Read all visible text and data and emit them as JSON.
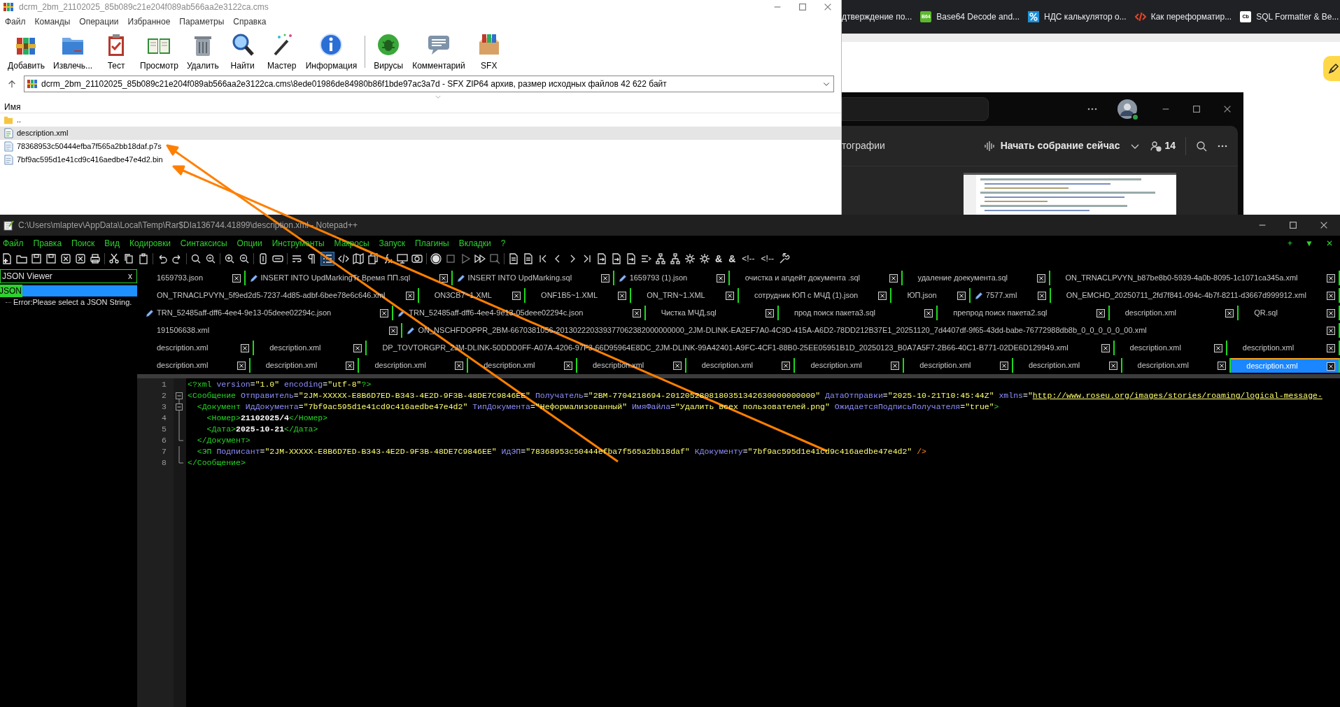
{
  "browser": {
    "bookmarks": [
      {
        "label": "дтверждение по...",
        "kind": "none"
      },
      {
        "label": "Base64 Decode and...",
        "kind": "b64",
        "badge": "B64"
      },
      {
        "label": "НДС калькулятор о...",
        "kind": "percent"
      },
      {
        "label": "Как переформатир...",
        "kind": "code"
      },
      {
        "label": "SQL Formatter & Be...",
        "kind": "cb",
        "badge": "Cb"
      }
    ]
  },
  "winrar": {
    "title": "dcrm_2bm_21102025_85b089c21e204f089ab566aa2e3122ca.cms",
    "menu": [
      "Файл",
      "Команды",
      "Операции",
      "Избранное",
      "Параметры",
      "Справка"
    ],
    "toolbar": [
      "Добавить",
      "Извлечь...",
      "Тест",
      "Просмотр",
      "Удалить",
      "Найти",
      "Мастер",
      "Информация",
      "Вирусы",
      "Комментарий",
      "SFX"
    ],
    "address": "dcrm_2bm_21102025_85b089c21e204f089ab566aa2e3122ca.cms\\8ede01986de84980b86f1bde97ac3a7d - SFX ZIP64 архив, размер исходных файлов 42 622 байт",
    "column": "Имя",
    "files": [
      {
        "name": "..",
        "kind": "parent",
        "selected": false
      },
      {
        "name": "description.xml",
        "kind": "xml",
        "selected": true
      },
      {
        "name": "78368953c50444efba7f565a2bb18daf.p7s",
        "kind": "file",
        "selected": false
      },
      {
        "name": "7bf9ac595d1e41cd9c416aedbe47e4d2.bin",
        "kind": "file",
        "selected": false
      }
    ]
  },
  "teams": {
    "tab_label": "тографии",
    "meeting_button": "Начать собрание сейчас",
    "participants": "14"
  },
  "notepad": {
    "title": "C:\\Users\\mlaptev\\AppData\\Local\\Temp\\Rar$DIa136744.41899\\description.xml - Notepad++",
    "menu": [
      "Файл",
      "Правка",
      "Поиск",
      "Вид",
      "Кодировки",
      "Синтаксисы",
      "Опции",
      "Инструменты",
      "Макросы",
      "Запуск",
      "Плагины",
      "Вкладки",
      "?"
    ],
    "menu_right": [
      "+",
      "▼",
      "✕"
    ],
    "toolbar_glyphs": [
      "&",
      "&",
      "<!--",
      "<!--"
    ],
    "panel": {
      "title": "JSON Viewer",
      "close": "x",
      "root": "JSON",
      "message": "Error:Please select a JSON String."
    },
    "tab_rows": [
      [
        {
          "label": "1659793.json",
          "modified": false,
          "selected": false
        },
        {
          "label": "INSERT INTO UpdMarkingTr Время ПП.sql",
          "modified": true,
          "selected": false
        },
        {
          "label": "INSERT INTO UpdMarking.sql",
          "modified": true,
          "selected": false
        },
        {
          "label": "1659793 (1).json",
          "modified": true,
          "selected": false
        },
        {
          "label": "очистка и апдейт документа .sql",
          "modified": false,
          "selected": false
        },
        {
          "label": "удаление доекумента.sql",
          "modified": false,
          "selected": false
        },
        {
          "label": "ON_TRNACLPVYN_b87be8b0-5939-4a0b-8095-1c1071ca345a.xml",
          "modified": false,
          "selected": false
        }
      ],
      [
        {
          "label": "ON_TRNACLPVYN_5f9ed2d5-7237-4d85-adbf-6bee78e6c646.xml",
          "modified": false,
          "selected": false
        },
        {
          "label": "ON3CB7~1.XML",
          "modified": false,
          "selected": false
        },
        {
          "label": "ONF1B5~1.XML",
          "modified": false,
          "selected": false
        },
        {
          "label": "ON_TRN~1.XML",
          "modified": false,
          "selected": false
        },
        {
          "label": "сотрудник ЮП с МЧД (1).json",
          "modified": false,
          "selected": false
        },
        {
          "label": "ЮП.json",
          "modified": false,
          "selected": false
        },
        {
          "label": "7577.xml",
          "modified": true,
          "selected": false
        },
        {
          "label": "ON_EMCHD_20250711_2fd7f841-094c-4b7f-8211-d3667d999912.xml",
          "modified": false,
          "selected": false
        }
      ],
      [
        {
          "label": "TRN_52485aff-dff6-4ee4-9e13-05deee02294c.json",
          "modified": true,
          "selected": false
        },
        {
          "label": "TRN_52485aff-dff6-4ee4-9e13-05deee02294c.json",
          "modified": true,
          "selected": false
        },
        {
          "label": "Чистка МЧД.sql",
          "modified": false,
          "selected": false
        },
        {
          "label": "прод поиск пакета3.sql",
          "modified": false,
          "selected": false
        },
        {
          "label": "препрод поиск пакета2.sql",
          "modified": false,
          "selected": false
        },
        {
          "label": "description.xml",
          "modified": false,
          "selected": false
        },
        {
          "label": "QR.sql",
          "modified": false,
          "selected": false
        }
      ],
      [
        {
          "label": "191506638.xml",
          "modified": false,
          "selected": false
        },
        {
          "label": "ON_NSCHFDOPPR_2BM-6670381056-201302220339377062382000000000_2JM-DLINK-EA2EF7A0-4C9D-415A-A6D2-78DD212B37E1_20251120_7d4407df-9f65-43dd-babe-76772988db8b_0_0_0_0_0_00.xml",
          "modified": true,
          "selected": false
        }
      ],
      [
        {
          "label": "description.xml",
          "modified": false,
          "selected": false
        },
        {
          "label": "description.xml",
          "modified": false,
          "selected": false
        },
        {
          "label": "DP_TOVTORGPR_2JM-DLINK-50DDD0FF-A07A-4206-97F3-66D95964E8DC_2JM-DLINK-99A42401-A9FC-4CF1-88B0-25EE05951B1D_20250123_B0A7A5F7-2B66-40C1-B771-02DE6D129949.xml",
          "modified": false,
          "selected": false
        },
        {
          "label": "description.xml",
          "modified": false,
          "selected": false
        },
        {
          "label": "description.xml",
          "modified": false,
          "selected": false
        }
      ],
      [
        {
          "label": "description.xml",
          "modified": false,
          "selected": false
        },
        {
          "label": "description.xml",
          "modified": false,
          "selected": false
        },
        {
          "label": "description.xml",
          "modified": false,
          "selected": false
        },
        {
          "label": "description.xml",
          "modified": false,
          "selected": false
        },
        {
          "label": "description.xml",
          "modified": false,
          "selected": false
        },
        {
          "label": "description.xml",
          "modified": false,
          "selected": false
        },
        {
          "label": "description.xml",
          "modified": false,
          "selected": false
        },
        {
          "label": "description.xml",
          "modified": false,
          "selected": false
        },
        {
          "label": "description.xml",
          "modified": false,
          "selected": false
        },
        {
          "label": "description.xml",
          "modified": false,
          "selected": false
        },
        {
          "label": "description.xml",
          "modified": false,
          "selected": true
        }
      ]
    ],
    "lines": [
      {
        "number": "1",
        "kind": "none",
        "segments": [
          {
            "kind": "tag",
            "text": "<?xml"
          },
          {
            "kind": "attr",
            "text": " version"
          },
          {
            "kind": "eq",
            "text": "="
          },
          {
            "kind": "value",
            "text": "\"1.0\""
          },
          {
            "kind": "attr",
            "text": " encoding"
          },
          {
            "kind": "eq",
            "text": "="
          },
          {
            "kind": "value",
            "text": "\"utf-8\""
          },
          {
            "kind": "tag",
            "text": "?>"
          }
        ]
      },
      {
        "number": "2",
        "kind": "box",
        "segments": [
          {
            "kind": "tag",
            "text": "<Сообщение"
          },
          {
            "kind": "attr",
            "text": " Отправитель"
          },
          {
            "kind": "eq",
            "text": "="
          },
          {
            "kind": "value",
            "text": "\"2JM-XXXXX-E8B6D7ED-B343-4E2D-9F3B-48DE7C9846EE\""
          },
          {
            "kind": "attr",
            "text": " Получатель"
          },
          {
            "kind": "eq",
            "text": "="
          },
          {
            "kind": "value",
            "text": "\"2BM-7704218694-2012052808180351342630000000000\""
          },
          {
            "kind": "attr",
            "text": " ДатаОтправки"
          },
          {
            "kind": "eq",
            "text": "="
          },
          {
            "kind": "value",
            "text": "\"2025-10-21T10:45:44Z\""
          },
          {
            "kind": "attr",
            "text": " xmlns"
          },
          {
            "kind": "eq",
            "text": "="
          },
          {
            "kind": "value",
            "text": "\""
          },
          {
            "kind": "link",
            "text": "http://www.roseu.org/images/stories/roaming/logical-message-"
          }
        ]
      },
      {
        "number": "3",
        "kind": "box",
        "segments": [
          {
            "kind": "tag",
            "text": "  <Документ"
          },
          {
            "kind": "attr",
            "text": " ИдДокумента"
          },
          {
            "kind": "eq",
            "text": "="
          },
          {
            "kind": "value",
            "text": "\"7bf9ac595d1e41cd9c416aedbe47e4d2\""
          },
          {
            "kind": "attr",
            "text": " ТипДокумента"
          },
          {
            "kind": "eq",
            "text": "="
          },
          {
            "kind": "value",
            "text": "\"Неформализованный\""
          },
          {
            "kind": "attr",
            "text": " ИмяФайла"
          },
          {
            "kind": "eq",
            "text": "="
          },
          {
            "kind": "value",
            "text": "\"Удалить всех пользователей.png\""
          },
          {
            "kind": "attr",
            "text": " ОжидаетсяПодписьПолучателя"
          },
          {
            "kind": "eq",
            "text": "="
          },
          {
            "kind": "value",
            "text": "\"true\""
          },
          {
            "kind": "tag",
            "text": ">"
          }
        ]
      },
      {
        "number": "4",
        "kind": "line",
        "segments": [
          {
            "kind": "tag",
            "text": "    <Номер>"
          },
          {
            "kind": "text",
            "text": "21102025/4"
          },
          {
            "kind": "tag",
            "text": "</Номер>"
          }
        ]
      },
      {
        "number": "5",
        "kind": "line",
        "segments": [
          {
            "kind": "tag",
            "text": "    <Дата>"
          },
          {
            "kind": "text",
            "text": "2025-10-21"
          },
          {
            "kind": "tag",
            "text": "</Дата>"
          }
        ]
      },
      {
        "number": "6",
        "kind": "end",
        "segments": [
          {
            "kind": "tag",
            "text": "  </Документ>"
          }
        ]
      },
      {
        "number": "7",
        "kind": "line",
        "segments": [
          {
            "kind": "tag",
            "text": "  <ЭП"
          },
          {
            "kind": "attr",
            "text": " Подписант"
          },
          {
            "kind": "eq",
            "text": "="
          },
          {
            "kind": "value",
            "text": "\"2JM-XXXXX-E8B6D7ED-B343-4E2D-9F3B-48DE7C9846EE\""
          },
          {
            "kind": "attr",
            "text": " ИдЭП"
          },
          {
            "kind": "eq",
            "text": "="
          },
          {
            "kind": "value",
            "text": "\"78368953c50444efba7f565a2bb18daf\""
          },
          {
            "kind": "attr",
            "text": " КДокументу"
          },
          {
            "kind": "eq",
            "text": "="
          },
          {
            "kind": "value",
            "text": "\"7bf9ac595d1e41cd9c416aedbe47e4d2\""
          },
          {
            "kind": "close",
            "text": " />"
          }
        ]
      },
      {
        "number": "8",
        "kind": "end",
        "segments": [
          {
            "kind": "tag",
            "text": "</Сообщение>"
          }
        ]
      }
    ]
  }
}
